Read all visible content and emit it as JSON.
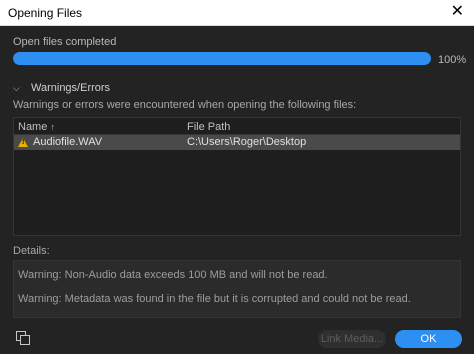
{
  "window": {
    "title": "Opening Files",
    "close_glyph": "✕"
  },
  "status": {
    "text": "Open files completed",
    "progress_percent": 100,
    "progress_label": "100%"
  },
  "warnings_section": {
    "header": "Warnings/Errors",
    "description": "Warnings or errors were encountered when opening the following files:"
  },
  "table": {
    "columns": {
      "name": "Name",
      "path": "File Path"
    },
    "sort_glyph": "↑",
    "rows": [
      {
        "name": "Audiofile.WAV",
        "path": "C:\\Users\\Roger\\Desktop",
        "icon": "warning-icon"
      }
    ]
  },
  "details": {
    "label": "Details:",
    "lines": [
      "Warning: Non-Audio data exceeds 100 MB and will not be read.",
      "Warning: Metadata was found in the file but it is corrupted and could not be read."
    ]
  },
  "buttons": {
    "link_media": "Link Media...",
    "ok": "OK"
  },
  "colors": {
    "accent": "#2e8ff2",
    "warning": "#e8b000",
    "background": "#232323"
  }
}
